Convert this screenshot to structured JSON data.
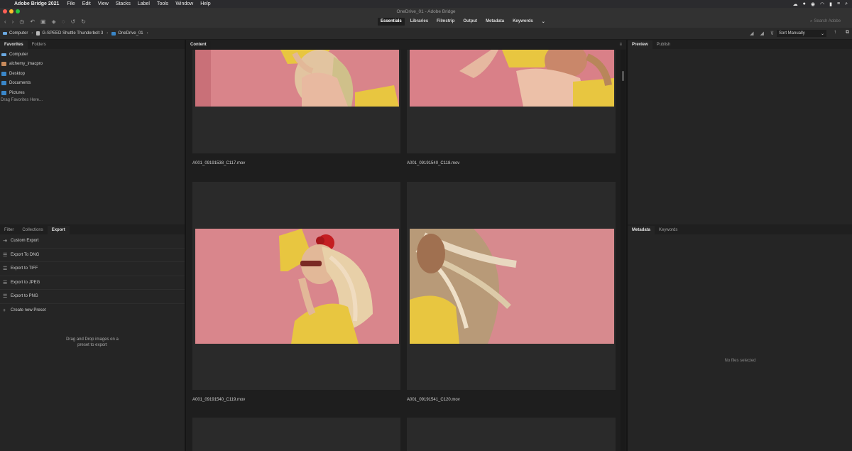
{
  "menubar": {
    "app_name": "Adobe Bridge 2021",
    "items": [
      "File",
      "Edit",
      "View",
      "Stacks",
      "Label",
      "Tools",
      "Window",
      "Help"
    ]
  },
  "titlebar": {
    "title": "OneDrive_01 - Adobe Bridge"
  },
  "workspaces": [
    "Essentials",
    "Libraries",
    "Filmstrip",
    "Output",
    "Metadata",
    "Keywords"
  ],
  "search": {
    "placeholder": "Search Adobe"
  },
  "path": {
    "computer": "Computer",
    "drive": "G-SPEED Shuttle Thunderbolt 3",
    "folder": "OneDrive_01"
  },
  "sort": {
    "label": "Sort Manually"
  },
  "favorites_panel": {
    "tabs": [
      "Favorites",
      "Folders"
    ],
    "items": [
      "Computer",
      "alchemy_imacpro",
      "Desktop",
      "Documents",
      "Pictures"
    ],
    "hint": "Drag Favorites Here..."
  },
  "export_panel": {
    "tabs": [
      "Filter",
      "Collections",
      "Export"
    ],
    "items": [
      "Custom Export",
      "Export To DNG",
      "Export to TIFF",
      "Export to JPEG",
      "Export to PNG",
      "Create new Preset"
    ],
    "drop_hint_1": "Drag and Drop images on a",
    "drop_hint_2": "preset to export"
  },
  "content_panel": {
    "tab": "Content",
    "files": [
      "A001_09191538_C117.mov",
      "A001_09191540_C118.mov",
      "A001_09191540_C119.mov",
      "A001_09191541_C120.mov"
    ]
  },
  "preview_panel": {
    "tabs": [
      "Preview",
      "Publish"
    ]
  },
  "metadata_panel": {
    "tabs": [
      "Metadata",
      "Keywords"
    ],
    "empty": "No files selected"
  },
  "colors": {
    "accent_folder": "#3a86c8",
    "pink_wall": "#d9848a",
    "yellow_dress": "#e8c640"
  }
}
